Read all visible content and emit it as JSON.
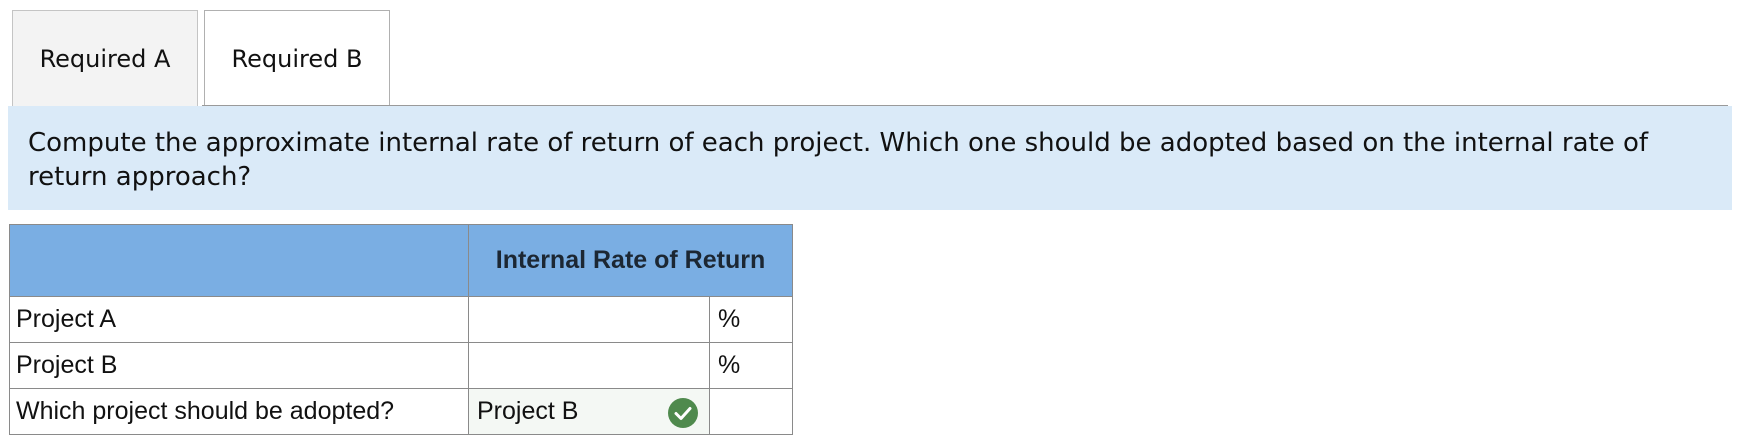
{
  "tabs": [
    {
      "label": "Required A",
      "active": false
    },
    {
      "label": "Required B",
      "active": true
    }
  ],
  "prompt": {
    "text": "Compute the approximate internal rate of return of each project. Which one should be adopted based on the internal rate of return approach?"
  },
  "table": {
    "header": "Internal Rate of Return",
    "rows": [
      {
        "label": "Project A",
        "value": "",
        "unit": "%"
      },
      {
        "label": "Project B",
        "value": "",
        "unit": "%"
      }
    ],
    "adoption_row": {
      "label": "Which project should be adopted?",
      "answer": "Project B",
      "status_icon": "check-circle-icon"
    }
  },
  "colors": {
    "prompt_bg": "#daeaf8",
    "header_bg": "#7aaee3",
    "correct_green": "#4f8a4d"
  }
}
